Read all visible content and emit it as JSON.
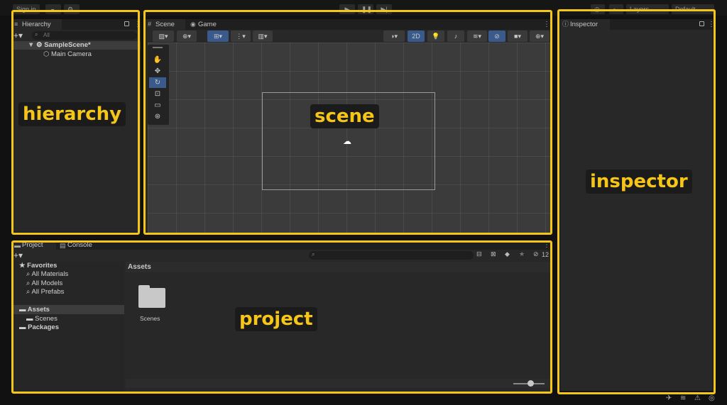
{
  "toolbar": {
    "sign_in": "Sign in",
    "cloud_icon": "cloud-icon",
    "collab_icon": "collab-icon",
    "play_icon": "play-icon",
    "pause_icon": "pause-icon",
    "step_icon": "step-icon",
    "layers_label": "Layers",
    "layout_label": "Default"
  },
  "hierarchy": {
    "tab": "Hierarchy",
    "search_placeholder": "All",
    "items": [
      {
        "label": "SampleScene*"
      },
      {
        "label": "Main Camera"
      }
    ],
    "callout": "hierarchy"
  },
  "scene": {
    "tabs": [
      {
        "label": "Scene"
      },
      {
        "label": "Game"
      }
    ],
    "toggle_2d": "2D",
    "callout": "scene"
  },
  "inspector": {
    "tab": "Inspector",
    "callout": "inspector"
  },
  "project": {
    "tabs": [
      {
        "label": "Project"
      },
      {
        "label": "Console"
      }
    ],
    "favorites": "Favorites",
    "favorite_items": [
      "All Materials",
      "All Models",
      "All Prefabs"
    ],
    "assets": "Assets",
    "scenes": "Scenes",
    "packages": "Packages",
    "breadcrumb": "Assets",
    "folder_label": "Scenes",
    "hidden_count": "12",
    "callout": "project"
  },
  "colors": {
    "highlight": "#f5c518",
    "panel_bg": "#282828",
    "accent_blue": "#3a5a8c"
  }
}
